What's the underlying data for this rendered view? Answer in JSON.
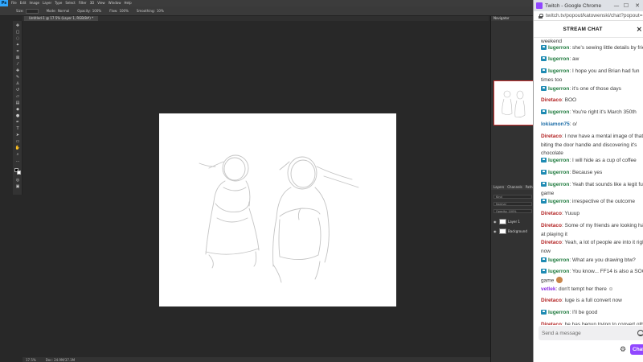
{
  "photoshop": {
    "menus": [
      "File",
      "Edit",
      "Image",
      "Layer",
      "Type",
      "Select",
      "Filter",
      "3D",
      "View",
      "Window",
      "Help"
    ],
    "options": {
      "size_label": "Size:",
      "mode_label": "Mode:",
      "mode_value": "Normal",
      "opacity_label": "Opacity:",
      "opacity_value": "100%",
      "flow_label": "Flow:",
      "flow_value": "100%",
      "smoothing_label": "Smoothing:",
      "smoothing_value": "10%"
    },
    "document_tab": "Untitled-1 @ 17.5% (Layer 1, RGB/8#) *",
    "status": {
      "zoom": "17.5%",
      "doc_size": "Doc: 24.9M/37.1M"
    },
    "panels": {
      "navigator_title": "Navigator",
      "layers_tabs": [
        "Layers",
        "Channels",
        "Paths"
      ],
      "kind_filter": "Kind",
      "blend_mode": "Normal",
      "opacity": "Opacity: 100%",
      "layers": [
        "Layer 1",
        "Background"
      ]
    }
  },
  "chrome": {
    "window_title": "Twitch - Google Chrome",
    "url": "twitch.tv/popout/katowenski/chat?popout=",
    "window_buttons": [
      "—",
      "☐",
      "✕"
    ]
  },
  "chat": {
    "header_title": "STREAM CHAT",
    "collapse_icon": "collapse-arrows-icon",
    "messages": [
      {
        "user": "",
        "text": "weekend",
        "color": "#3a3a3a",
        "badge": false
      },
      {
        "user": "lugerron",
        "text": ": she's sewing little details by friend",
        "color": "#1e7a3d",
        "badge": true
      },
      {
        "user": "lugerron",
        "text": ": aw",
        "color": "#1e7a3d",
        "badge": true
      },
      {
        "user": "lugerron",
        "text": ": I hope you and Brian had fun",
        "cont": "times too",
        "color": "#1e7a3d",
        "badge": true
      },
      {
        "user": "lugerron",
        "text": ": it's one of those days",
        "color": "#1e7a3d",
        "badge": true
      },
      {
        "user": "Diretaco",
        "text": ": BOO",
        "color": "#b22222",
        "badge": false
      },
      {
        "user": "lugerron",
        "text": ": You're right it's March 350th",
        "color": "#1e7a3d",
        "badge": true
      },
      {
        "user": "lokiamon75",
        "text": ": o/",
        "color": "#1f6fa8",
        "badge": false
      },
      {
        "user": "Diretaco",
        "text": ": I now have a mental image of that guy",
        "cont": "biting the door handle and discovering it's",
        "cont2": "chocolate",
        "color": "#b22222",
        "badge": false
      },
      {
        "user": "lugerron",
        "text": ": I will hide as a cup of coffee",
        "color": "#1e7a3d",
        "badge": true
      },
      {
        "user": "lugerron",
        "text": ": Because yes",
        "color": "#1e7a3d",
        "badge": true
      },
      {
        "user": "lugerron",
        "text": ": Yeah that sounds like a legit fun",
        "cont": "game",
        "color": "#1e7a3d",
        "badge": true
      },
      {
        "user": "lugerron",
        "text": ": irrespective of the outcome",
        "color": "#1e7a3d",
        "badge": true
      },
      {
        "user": "Diretaco",
        "text": ": Yuuup",
        "color": "#b22222",
        "badge": false
      },
      {
        "user": "Diretaco",
        "text": ": Some of my friends are looking hard",
        "cont": "at playing it",
        "color": "#b22222",
        "badge": false
      },
      {
        "user": "Diretaco",
        "text": ": Yeah, a lot of people are into it right",
        "cont": "now",
        "color": "#b22222",
        "badge": false
      },
      {
        "user": "lugerron",
        "text": ": What are you drawing btw?",
        "color": "#1e7a3d",
        "badge": true
      },
      {
        "user": "lugerron",
        "text": ": You know... FF14 is also a SOCIAL",
        "cont": "game",
        "color": "#1e7a3d",
        "badge": true
      },
      {
        "user": "vetlek",
        "text": ": don't tempt her there ☺",
        "color": "#8a2be2",
        "badge": false
      },
      {
        "user": "Diretaco",
        "text": ": luge is a full convert now",
        "color": "#b22222",
        "badge": false
      },
      {
        "user": "lugerron",
        "text": ": I'll be good",
        "color": "#1e7a3d",
        "badge": true
      },
      {
        "user": "Diretaco",
        "text": ": he has begun trying to convert others",
        "color": "#b22222",
        "badge": false
      }
    ],
    "input_placeholder": "Send a message",
    "chat_button_label": "Chat",
    "settings_icon": "gear-icon",
    "emote_icon": "smiley-icon"
  }
}
